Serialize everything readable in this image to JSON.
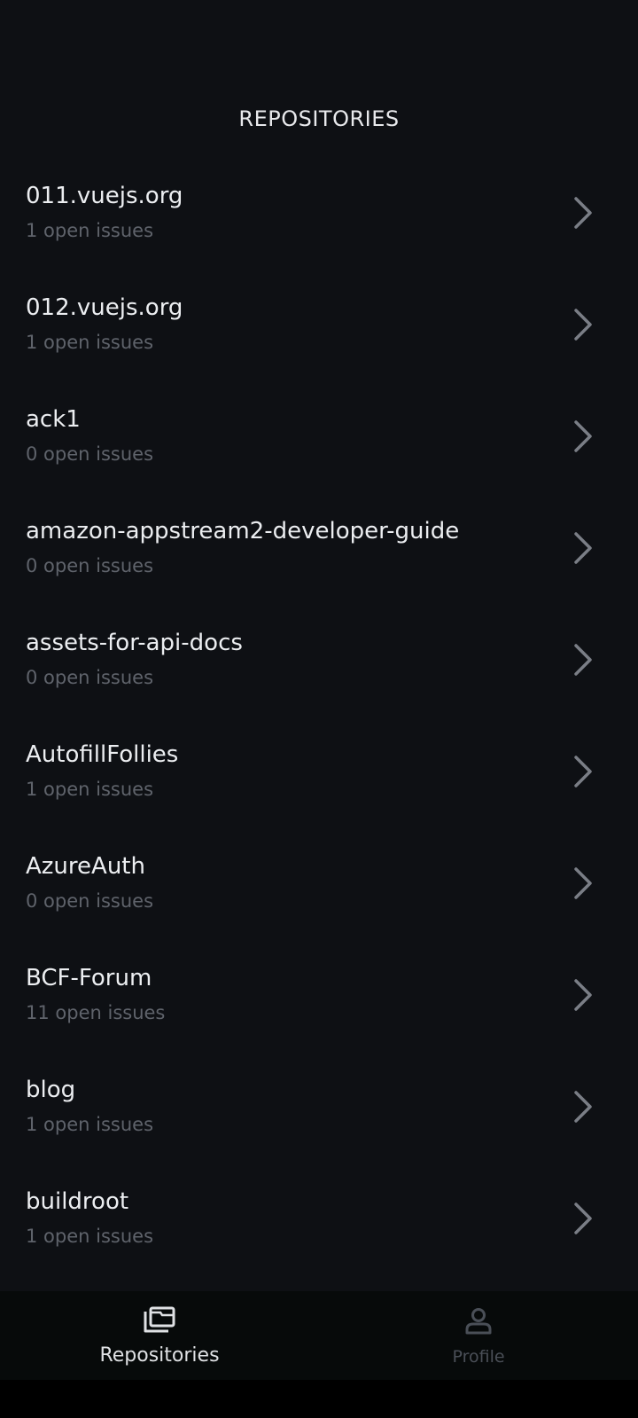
{
  "header": {
    "title": "REPOSITORIES"
  },
  "repositories": [
    {
      "name": "011.vuejs.org",
      "issues": "1 open issues"
    },
    {
      "name": "012.vuejs.org",
      "issues": "1 open issues"
    },
    {
      "name": "ack1",
      "issues": "0 open issues"
    },
    {
      "name": "amazon-appstream2-developer-guide",
      "issues": "0 open issues"
    },
    {
      "name": "assets-for-api-docs",
      "issues": "0 open issues"
    },
    {
      "name": "AutofillFollies",
      "issues": "1 open issues"
    },
    {
      "name": "AzureAuth",
      "issues": "0 open issues"
    },
    {
      "name": "BCF-Forum",
      "issues": "11 open issues"
    },
    {
      "name": "blog",
      "issues": "1 open issues"
    },
    {
      "name": "buildroot",
      "issues": "1 open issues"
    }
  ],
  "nav": {
    "repositories_label": "Repositories",
    "profile_label": "Profile",
    "repositories_icon": "folders-icon",
    "profile_icon": "person-icon",
    "row_icon": "chevron-right-icon"
  },
  "colors": {
    "background": "#0e1014",
    "navbar": "#070a0a",
    "text_primary": "#eceef1",
    "text_secondary": "#5f636b",
    "chevron": "#7a7e86"
  }
}
